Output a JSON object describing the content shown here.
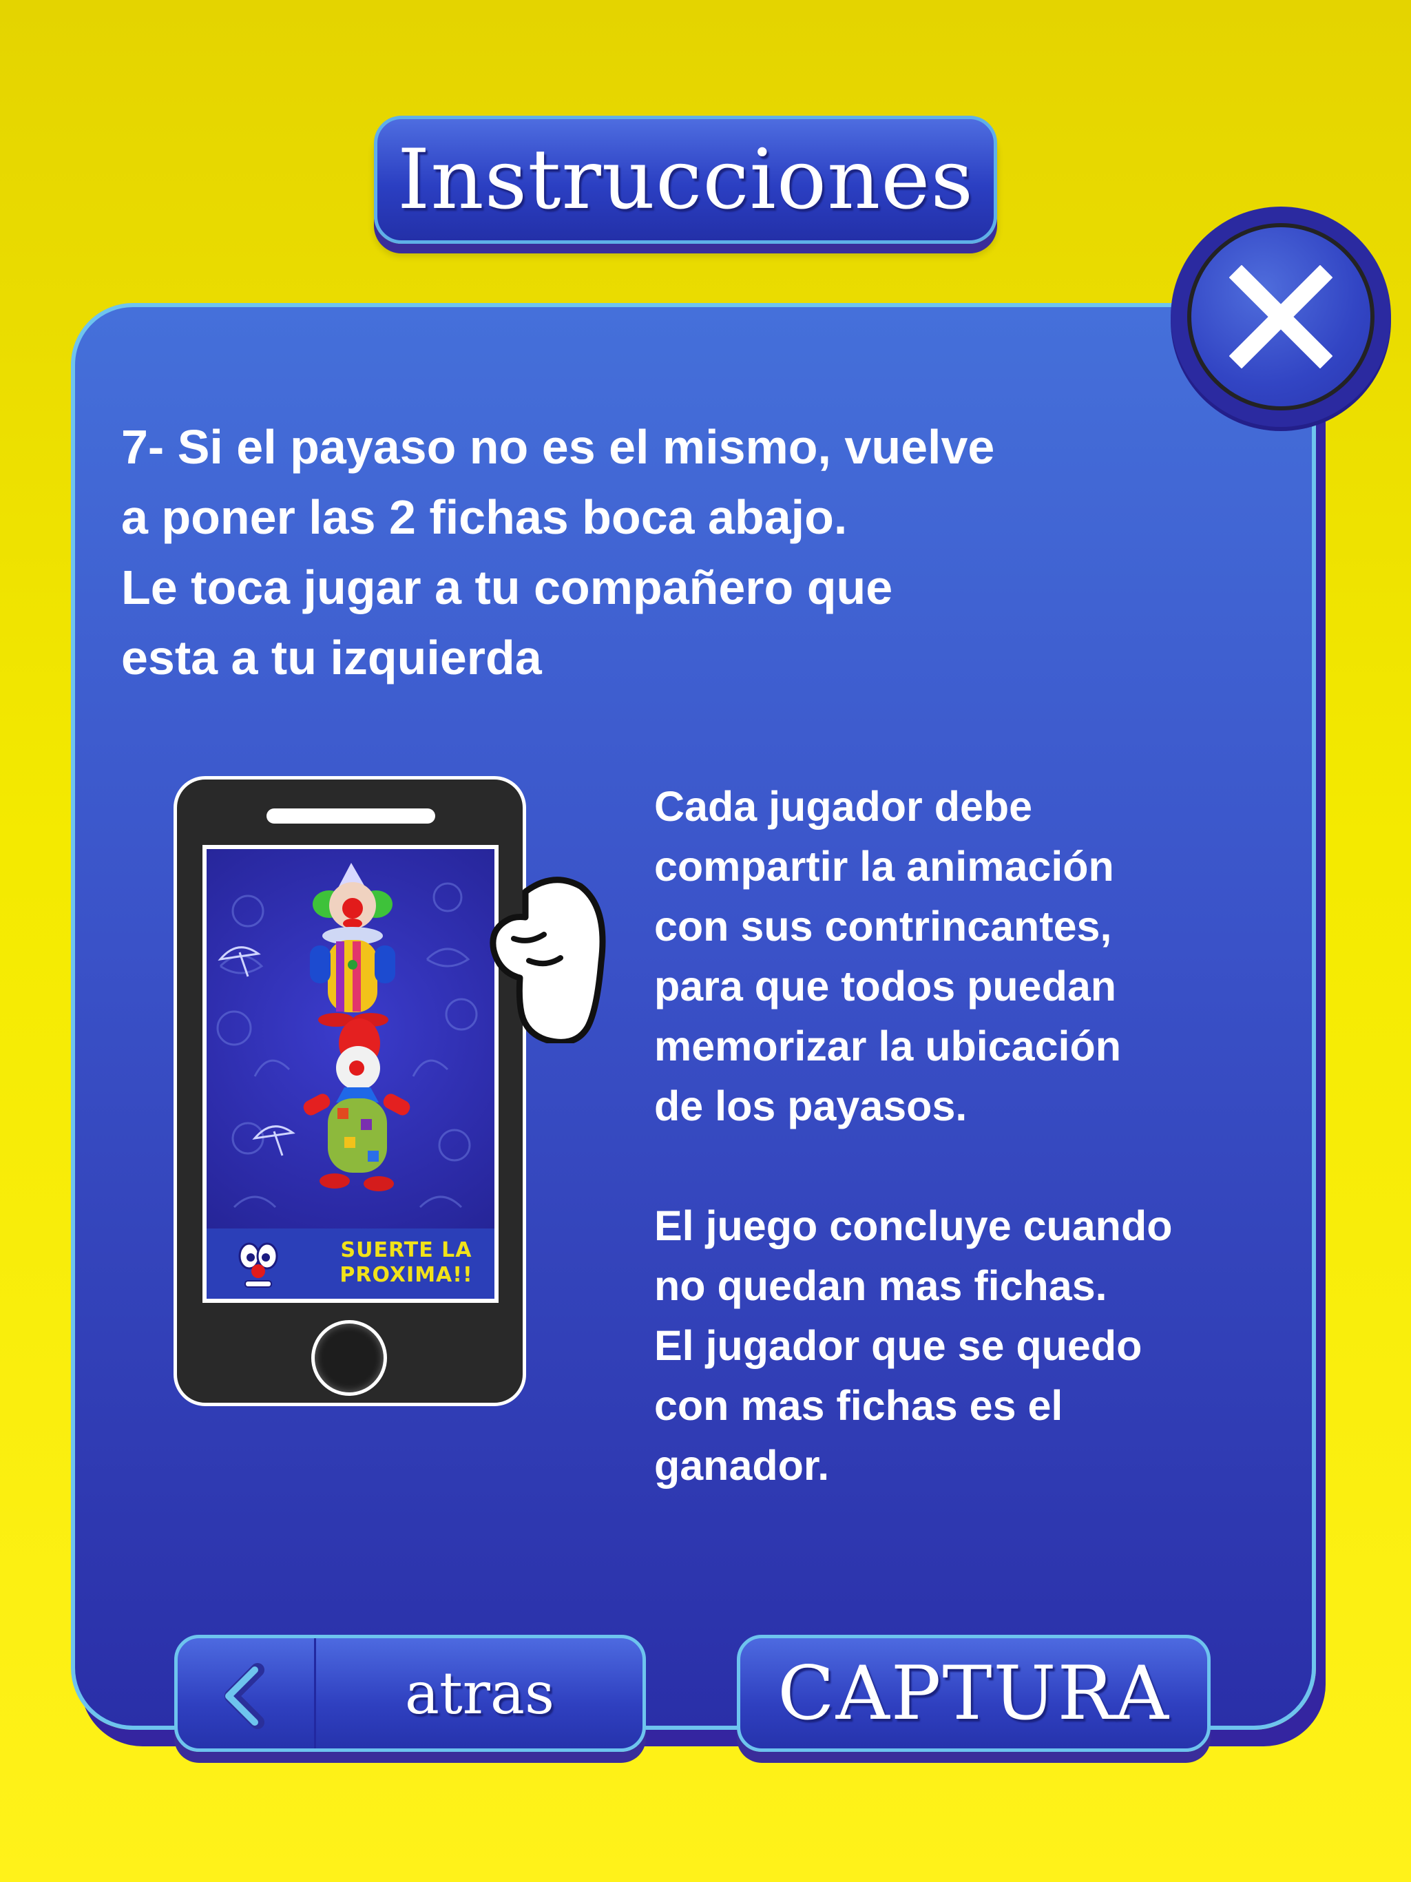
{
  "header": {
    "title": "Instrucciones"
  },
  "instructions": {
    "step_lines": [
      "7- Si el payaso no  es el mismo, vuelve",
      "a poner las 2 fichas boca abajo.",
      "Le toca jugar a tu compañero que",
      "esta a tu izquierda"
    ],
    "share_lines": [
      "Cada jugador debe",
      "compartir la animación",
      "con sus contrincantes,",
      "para que todos puedan",
      "memorizar la ubicación",
      "de los payasos."
    ],
    "end_lines": [
      "El juego concluye cuando",
      "no quedan mas fichas.",
      "El jugador que se quedo",
      "con mas fichas es el",
      "ganador."
    ]
  },
  "phone": {
    "banner_line1": "SUERTE LA",
    "banner_line2": "PROXIMA!!"
  },
  "footer": {
    "back_label": "atras",
    "capture_label": "CAPTURA"
  },
  "icons": {
    "close": "close-icon",
    "back": "chevron-left-icon"
  },
  "colors": {
    "background": "#f4ea00",
    "panel": "#3a52c8",
    "border": "#6ec4ee",
    "banner_text": "#f1e21a"
  }
}
